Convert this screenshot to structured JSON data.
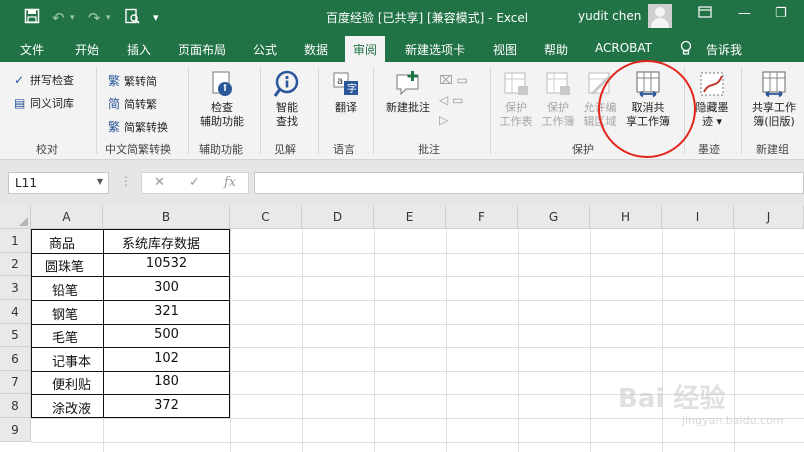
{
  "titlebar": {
    "title": "百度经验  [已共享]  [兼容模式]  -  Excel",
    "user": "yudit chen"
  },
  "tabs": [
    "文件",
    "开始",
    "插入",
    "页面布局",
    "公式",
    "数据",
    "审阅",
    "新建选项卡",
    "视图",
    "帮助",
    "ACROBAT"
  ],
  "active_tab": "审阅",
  "tell_me": "告诉我",
  "ribbon": {
    "proofing": {
      "spell": "拼写检查",
      "thesaurus": "同义词库",
      "label": "校对"
    },
    "chinese": {
      "t2s": "繁转简",
      "s2t": "简转繁",
      "convert": "简繁转换",
      "label": "中文简繁转换"
    },
    "accessibility": {
      "line1": "检查",
      "line2": "辅助功能",
      "label": "辅助功能"
    },
    "insights": {
      "line1": "智能",
      "line2": "查找",
      "label": "见解"
    },
    "language": {
      "translate": "翻译",
      "label": "语言"
    },
    "comments": {
      "new": "新建批注",
      "label": "批注"
    },
    "protect": {
      "sheet": {
        "line1": "保护",
        "line2": "工作表"
      },
      "workbook": {
        "line1": "保护",
        "line2": "工作簿"
      },
      "allow": {
        "line1": "允许编",
        "line2": "辑区域"
      },
      "unshare": {
        "line1": "取消共",
        "line2": "享工作簿"
      },
      "label": "保护"
    },
    "ink": {
      "line1": "隐藏墨",
      "line2": "迹 ▾",
      "label": "墨迹"
    },
    "share": {
      "line1": "共享工作",
      "line2": "簿(旧版)",
      "label": "新建组"
    }
  },
  "formula_bar": {
    "name_box": "L11",
    "cancel": "✕",
    "enter": "✓",
    "fx": "fx"
  },
  "sheet": {
    "columns": [
      "A",
      "B",
      "C",
      "D",
      "E",
      "F",
      "G",
      "H",
      "I",
      "J"
    ],
    "rows": [
      "1",
      "2",
      "3",
      "4",
      "5",
      "6",
      "7",
      "8",
      "9"
    ],
    "header": [
      "商品",
      "系统库存数据"
    ],
    "data": [
      [
        "圆珠笔",
        "10532"
      ],
      [
        "铅笔",
        "300"
      ],
      [
        "钢笔",
        "321"
      ],
      [
        "毛笔",
        "500"
      ],
      [
        "记事本",
        "102"
      ],
      [
        "便利贴",
        "180"
      ],
      [
        "涂改液",
        "372"
      ]
    ]
  },
  "watermark": {
    "main": "Bai 经验",
    "sub": "jingyan.baidu.com"
  }
}
